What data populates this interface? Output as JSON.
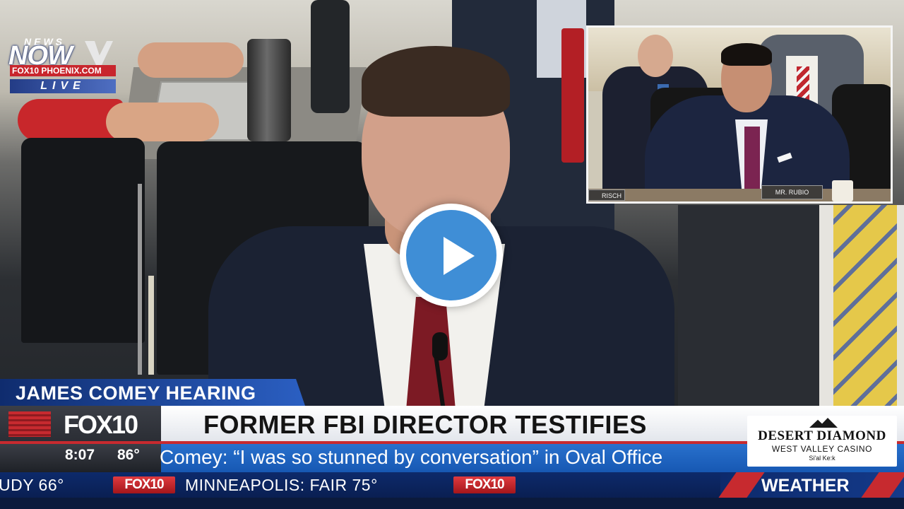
{
  "logo": {
    "news": "NEWS",
    "now": "NOW",
    "site": "FOX10 PHOENIX.COM",
    "live": "LIVE"
  },
  "inset": {
    "nameplate": "MR. RUBIO",
    "nameplate_partial": "RISCH"
  },
  "player": {
    "play_icon": "play-icon",
    "accent": "#3f8ed6"
  },
  "lower_third": {
    "topic": "JAMES COMEY HEARING",
    "station": "FOX10",
    "headline": "FORMER FBI DIRECTOR TESTIFIES",
    "subheadline": "Comey: “I was so stunned by conversation” in Oval Office",
    "time": "8:07",
    "temperature": "86°",
    "sponsor": {
      "name": "DESERT DIAMOND",
      "tagline": "WEST VALLEY CASINO",
      "subtitle": "Si'al Ke:k"
    }
  },
  "ticker": {
    "item_left": "UDY 66°",
    "badge": "FOX10",
    "item_main": "MINNEAPOLIS:  FAIR  75°",
    "badge2": "FOX10",
    "weather_label": "WEATHER"
  },
  "colors": {
    "fox_red": "#c72a2f",
    "ticker_blue": "#0d2a6b",
    "strip_blue": "#2a73cf"
  }
}
